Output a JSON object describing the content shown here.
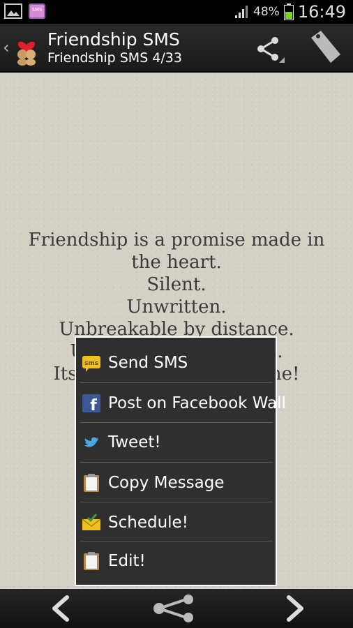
{
  "status_bar": {
    "sms_icon_text": "SMS",
    "battery_percent": "48%",
    "time": "16:49"
  },
  "action_bar": {
    "title": "Friendship SMS",
    "subtitle": "Friendship SMS 4/33"
  },
  "message": {
    "lines": [
      "Friendship is a promise made in",
      "the heart.",
      "Silent.",
      "Unwritten.",
      "Unbreakable by distance.",
      "Unchangeable by time.",
      "Its lovely to have u as one!"
    ]
  },
  "menu": {
    "items": [
      {
        "label": "Send SMS",
        "icon": "sms-icon"
      },
      {
        "label": "Post on Facebook Wall",
        "icon": "facebook-icon"
      },
      {
        "label": "Tweet!",
        "icon": "twitter-icon"
      },
      {
        "label": "Copy Message",
        "icon": "clipboard-icon"
      },
      {
        "label": "Schedule!",
        "icon": "envelope-check-icon"
      },
      {
        "label": "Edit!",
        "icon": "clipboard-icon"
      }
    ]
  },
  "colors": {
    "content_bg": "#d4d0c6",
    "menu_bg": "#2f2f2f",
    "battery_green": "#7ed321"
  }
}
